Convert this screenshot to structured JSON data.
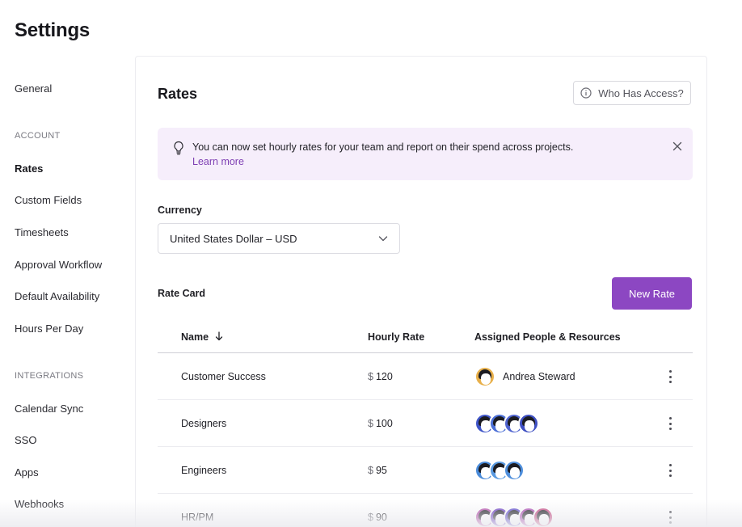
{
  "page": {
    "title": "Settings"
  },
  "sidebar": {
    "general": "General",
    "account_header": "ACCOUNT",
    "account_items": [
      "Rates",
      "Custom Fields",
      "Timesheets",
      "Approval Workflow",
      "Default Availability",
      "Hours Per Day"
    ],
    "integrations_header": "INTEGRATIONS",
    "integration_items": [
      "Calendar Sync",
      "SSO",
      "Apps",
      "Webhooks"
    ],
    "active": "Rates"
  },
  "rates": {
    "title": "Rates",
    "access_button": "Who Has Access?",
    "banner": {
      "text": "You can now set hourly rates for your team and report on their spend across projects.",
      "link": "Learn more"
    },
    "currency": {
      "label": "Currency",
      "value": "United States Dollar – USD"
    },
    "rate_card": {
      "label": "Rate Card",
      "new_button": "New Rate",
      "columns": [
        "Name",
        "Hourly Rate",
        "Assigned People & Resources"
      ],
      "rows": [
        {
          "name": "Customer Success",
          "currency": "$",
          "rate": "120",
          "assigned": "Andrea Steward",
          "avatar_colors": [
            "#e8b04a"
          ]
        },
        {
          "name": "Designers",
          "currency": "$",
          "rate": "100",
          "assigned": "",
          "avatar_colors": [
            "#3f55c8",
            "#4b6fd6",
            "#4f63cf",
            "#3e4fc2"
          ]
        },
        {
          "name": "Engineers",
          "currency": "$",
          "rate": "95",
          "assigned": "",
          "avatar_colors": [
            "#4a8bd9",
            "#5a9ae0",
            "#4f8fdc"
          ]
        },
        {
          "name": "HR/PM",
          "currency": "$",
          "rate": "90",
          "assigned": "",
          "avatar_colors": [
            "#b04aa6",
            "#6a3fc0",
            "#5a48c8",
            "#a94ab0",
            "#c2467e"
          ]
        }
      ]
    }
  },
  "colors": {
    "accent": "#8c47c2",
    "banner_bg": "#f6eefb",
    "link": "#7e3fb3"
  },
  "icons": {
    "info": "info-circle-icon",
    "bulb": "lightbulb-icon",
    "close": "close-icon",
    "chevron": "chevron-down-icon",
    "sort": "arrow-down-icon",
    "more": "kebab-menu-icon"
  }
}
